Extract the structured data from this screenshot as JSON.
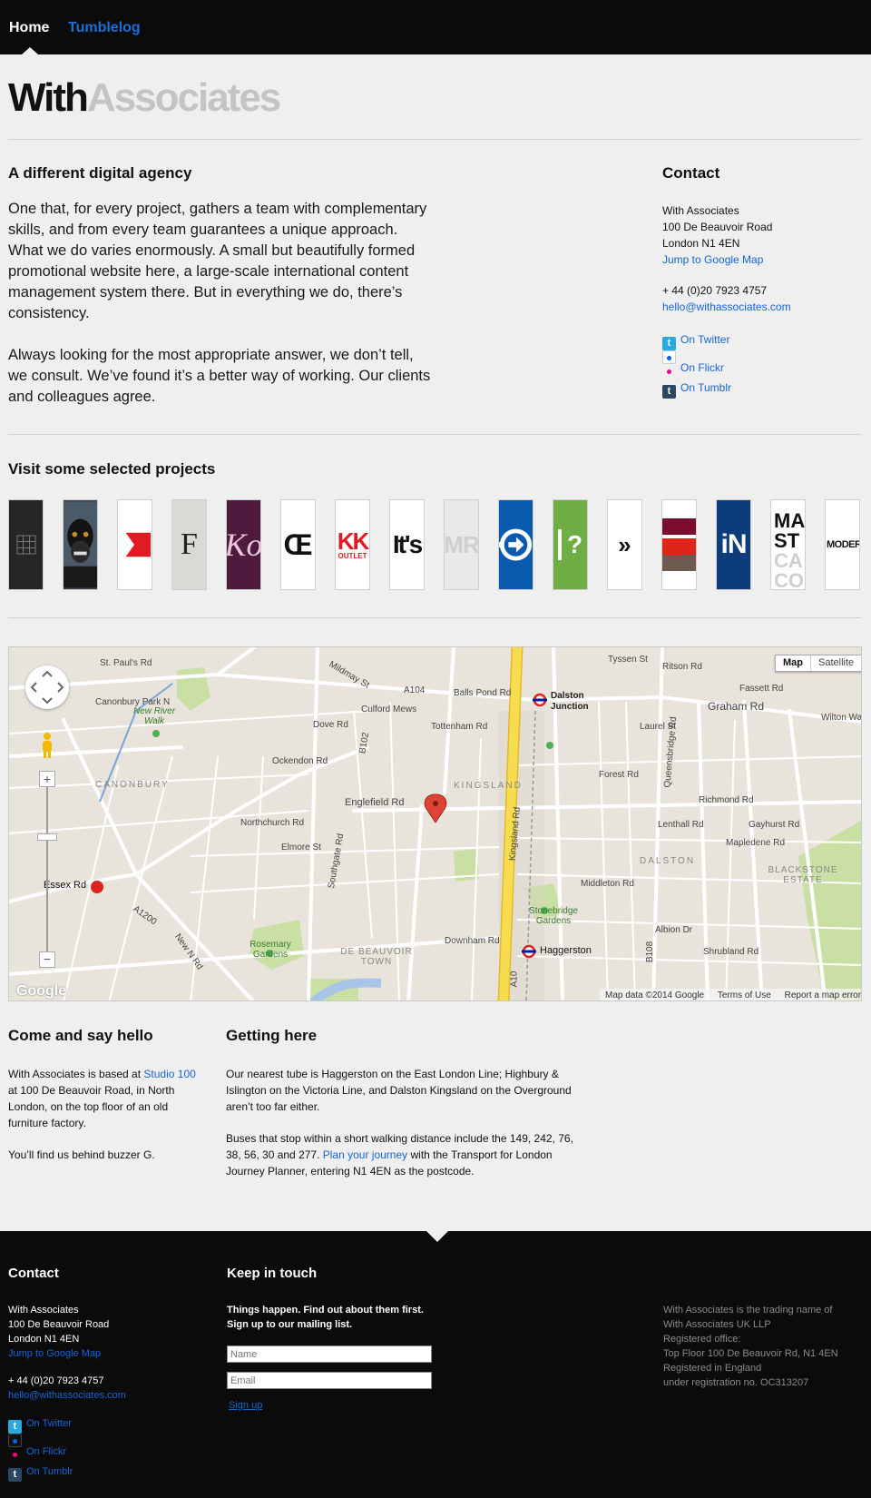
{
  "nav": {
    "home": "Home",
    "tumblelog": "Tumblelog"
  },
  "logo": {
    "part1": "With",
    "part2": "Associates"
  },
  "intro": {
    "heading": "A different digital agency",
    "para1": "One that, for every project, gathers a team with complementary skills, and from every team guarantees a unique approach. What we do varies enormously. A small but beautifully formed promotional website here, a large-scale international content management system there. But in everything we do, there’s consistency.",
    "para2": "Always looking for the most appropriate answer, we don’t tell, we consult. We’ve found it’s a better way of working. Our clients and colleagues agree."
  },
  "contact": {
    "heading": "Contact",
    "name": "With Associates",
    "street": "100 De Beauvoir Road",
    "city": "London N1 4EN",
    "map_link": "Jump to Google Map",
    "phone": "+ 44 (0)20 7923 4757",
    "email": "hello@withassociates.com",
    "twitter": "On Twitter",
    "flickr": "On Flickr",
    "tumblr": "On Tumblr",
    "icons": [
      "twitter-icon",
      "flickr-icon",
      "tumblr-icon"
    ]
  },
  "projects": {
    "heading": "Visit some selected projects",
    "tile_text": [
      "F",
      "Ko",
      "Œ",
      "KK",
      "OUTLET",
      "It's",
      "MR",
      "?",
      "»",
      "iN",
      "MA",
      "ST",
      "CA",
      "CO",
      "MODERN"
    ]
  },
  "map": {
    "btn_map": "Map",
    "btn_satellite": "Satellite",
    "labels": [
      "St. Paul's Rd",
      "Balls Pond Rd",
      "A104",
      "Dalston Junction",
      "Graham Rd",
      "Canonbury Park N",
      "New River Walk",
      "Culford Mews",
      "Tottenham Rd",
      "Englefield Rd",
      "KINGSLAND",
      "CANONBURY",
      "Essex Rd",
      "DALSTON",
      "BLACKSTONE ESTATE",
      "Stonebridge Gardens",
      "Haggerston",
      "Rosemary Gardens",
      "DE BEAUVOIR TOWN",
      "Kingsland Rd",
      "Queensbridge Rd",
      "Downham Rd",
      "Middleton Rd",
      "Southgate Rd",
      "A10",
      "B102",
      "B108",
      "A1200",
      "Forest Rd",
      "Mapledene Rd",
      "Richmond Rd",
      "Lenthall Rd",
      "Albion Dr",
      "Shrubland Rd",
      "Northchurch Rd",
      "Elmore St",
      "Ockendon Rd",
      "Dove Rd",
      "Mildmay St",
      "Laurel St",
      "Fassett Rd",
      "Ritson Rd",
      "Tyssen St",
      "Wilton Way",
      "Gayhurst Rd",
      "New N Rd",
      "Google"
    ],
    "attribution": "Map data ©2014 Google",
    "terms": "Terms of Use",
    "report": "Report a map error"
  },
  "hello": {
    "heading": "Come and say hello",
    "p1_pre": "With Associates is based at ",
    "p1_link": "Studio 100",
    "p1_post": " at 100 De Beauvoir Road, in North London, on the top floor of an old furniture factory.",
    "p2": "You’ll find us behind buzzer G."
  },
  "getting": {
    "heading": "Getting here",
    "p1": "Our nearest tube is Haggerston on the East London Line; Highbury & Islington on the Victoria Line, and Dalston Kingsland on the Overground aren’t too far either.",
    "p2_pre": "Buses that stop within a short walking distance include the 149, 242, 76, 38, 56, 30 and 277. ",
    "p2_link": "Plan your journey",
    "p2_post": " with the Transport for London Journey Planner, entering N1 4EN as the postcode."
  },
  "footer": {
    "contact_heading": "Contact",
    "name": "With Associates",
    "street": "100 De Beauvoir Road",
    "city": "London N1 4EN",
    "map_link": "Jump to Google Map",
    "phone": "+ 44 (0)20 7923 4757",
    "email": "hello@withassociates.com",
    "twitter": "On Twitter",
    "flickr": "On Flickr",
    "tumblr": "On Tumblr",
    "keep_heading": "Keep in touch",
    "keep_line1": "Things happen. Find out about them first.",
    "keep_line2": "Sign up to our mailing list.",
    "name_placeholder": "Name",
    "email_placeholder": "Email",
    "signup": "Sign up",
    "legal1": "With Associates is the trading name of",
    "legal2": "With Associates UK LLP",
    "legal3": "Registered office:",
    "legal4": "Top Floor 100 De Beauvoir Rd, N1 4EN",
    "legal5": "Registered in England",
    "legal6": "under registration no. OC313207"
  }
}
